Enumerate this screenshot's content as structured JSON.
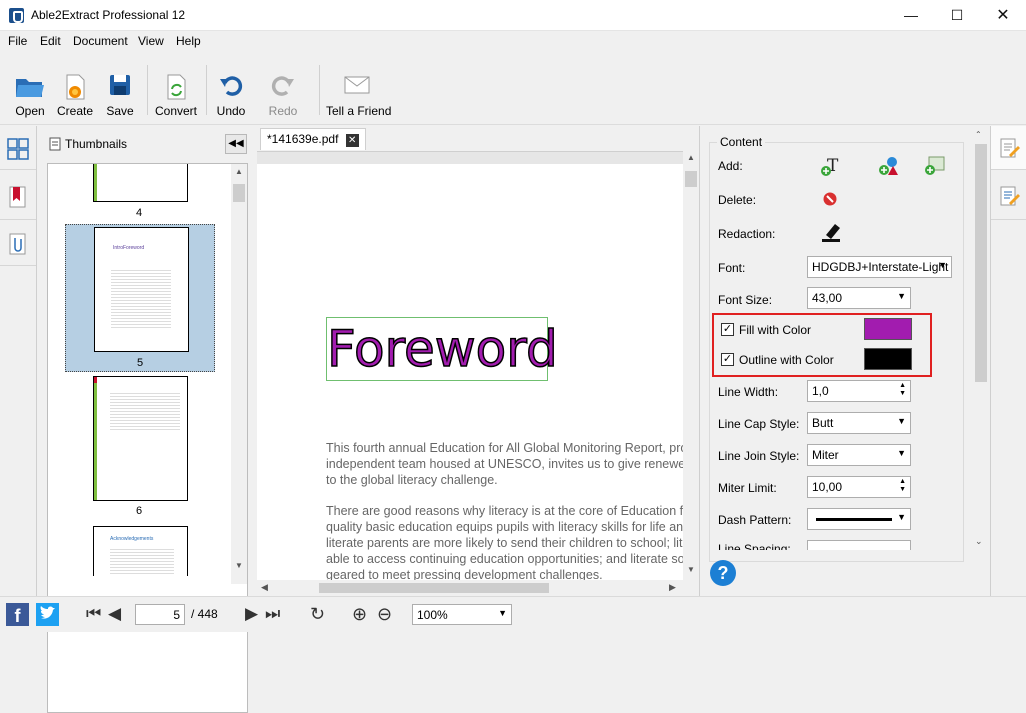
{
  "window": {
    "title": "Able2Extract Professional 12",
    "minimize_icon": "minimize-icon",
    "maximize_icon": "maximize-icon",
    "close_icon": "close-icon"
  },
  "menu": [
    "File",
    "Edit",
    "Document",
    "View",
    "Help"
  ],
  "toolbar": {
    "open": "Open",
    "create": "Create",
    "save": "Save",
    "convert": "Convert",
    "undo": "Undo",
    "redo": "Redo",
    "tell": "Tell a Friend"
  },
  "thumbnails": {
    "label": "Thumbnails",
    "collapse_icon": "double-chevron-left-icon",
    "pages": [
      {
        "num": "4",
        "heading": ""
      },
      {
        "num": "5",
        "heading": "IntroForeword"
      },
      {
        "num": "6",
        "heading": ""
      },
      {
        "num": "",
        "heading": "Acknowledgements"
      }
    ]
  },
  "document": {
    "tab": "*141639e.pdf",
    "heading": "Foreword",
    "paragraph1": [
      "This fourth annual Education for All Global Monitoring Report, pro",
      "independent team housed at UNESCO, invites us to give renewed",
      "to the global literacy challenge."
    ],
    "paragraph2": [
      "There are good reasons why literacy is at the core of Education fo",
      "quality basic education equips pupils with literacy skills for life and",
      "literate parents are more likely to send their children to school; lit",
      "able to access continuing education opportunities; and literate soc",
      "geared to meet pressing development challenges."
    ]
  },
  "properties": {
    "group": "Content",
    "add": "Add:",
    "delete": "Delete:",
    "redaction": "Redaction:",
    "font_label": "Font:",
    "font_value": "HDGDBJ+Interstate-Light",
    "font_size_label": "Font Size:",
    "font_size_value": "43,00",
    "fill_label": "Fill with Color",
    "fill_color": "#a21caf",
    "fill_checked": true,
    "outline_label": "Outline with Color",
    "outline_color": "#000000",
    "outline_checked": true,
    "line_width_label": "Line Width:",
    "line_width_value": "1,0",
    "line_cap_label": "Line Cap Style:",
    "line_cap_value": "Butt",
    "line_join_label": "Line Join Style:",
    "line_join_value": "Miter",
    "miter_label": "Miter Limit:",
    "miter_value": "10,00",
    "dash_label": "Dash Pattern:",
    "line_spacing_label": "Line Spacing:",
    "highlight_color": "#e02020"
  },
  "status": {
    "page_current": "5",
    "page_total": "/ 448",
    "zoom": "100%"
  }
}
